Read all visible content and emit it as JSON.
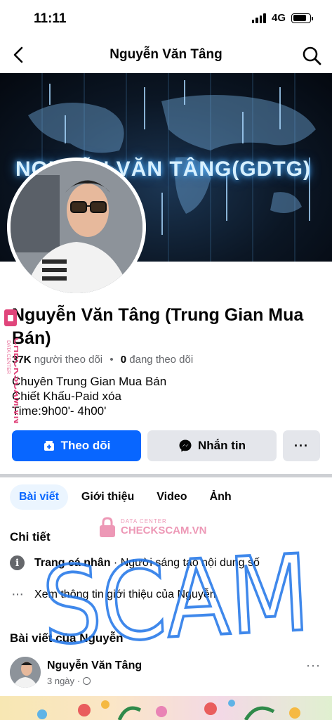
{
  "status": {
    "time": "11:11",
    "network": "4G"
  },
  "nav": {
    "title": "Nguyễn Văn Tâng"
  },
  "cover": {
    "text": "NGUYỄN VĂN TÂNG(GDTG)"
  },
  "profile": {
    "name": "Nguyễn Văn Tâng (Trung Gian Mua Bán)",
    "followers_count": "37K",
    "followers_label": "người theo dõi",
    "separator": "•",
    "following_count": "0",
    "following_label": "đang theo dõi",
    "bio": [
      "Chuyên Trung Gian Mua Bán",
      "Chiết Khấu-Paid xóa",
      "Time:9h00'- 4h00'"
    ]
  },
  "actions": {
    "follow": "Theo dõi",
    "message": "Nhắn tin",
    "more": "···"
  },
  "tabs": [
    {
      "label": "Bài viết",
      "active": true
    },
    {
      "label": "Giới thiệu",
      "active": false
    },
    {
      "label": "Video",
      "active": false
    },
    {
      "label": "Ảnh",
      "active": false
    }
  ],
  "details": {
    "title": "Chi tiết",
    "page_type": "Trang cá nhân",
    "page_category": " · Người sáng tạo nội dung số",
    "see_more": "Xem thông tin giới thiệu của Nguyễn"
  },
  "posts": {
    "title": "Bài viết của Nguyễn",
    "author": "Nguyễn Văn Tâng",
    "time": "3 ngày",
    "dot": "·"
  },
  "watermark": {
    "vertical_text": "CHECKSCAM.VN",
    "vertical_small": "DATA CENTER",
    "center_small": "DATA CENTER",
    "center_text": "CHECKSCAM.VN",
    "scrawl": "SCAM"
  },
  "colors": {
    "facebook_blue": "#0866ff",
    "watermark_pink": "#e0457b",
    "scrawl_blue": "#1e74e8"
  }
}
